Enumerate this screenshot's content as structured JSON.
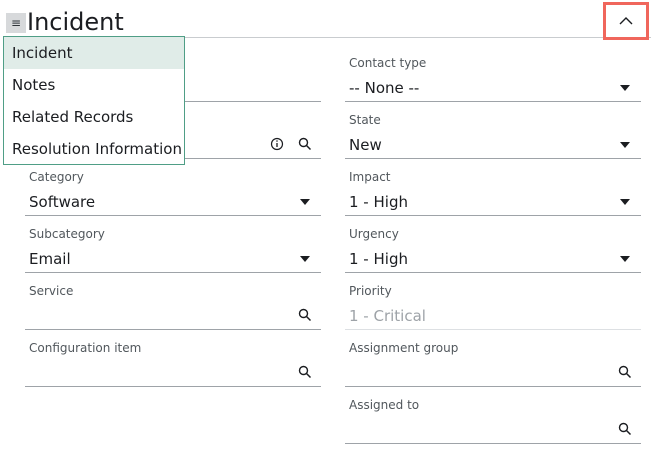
{
  "header": {
    "title": "Incident",
    "menu_glyph": "≡",
    "menu_icon": "hamburger-icon",
    "collapse_icon": "chevron-up-icon"
  },
  "section_menu": {
    "items": [
      {
        "label": "Incident",
        "active": true
      },
      {
        "label": "Notes",
        "active": false
      },
      {
        "label": "Related Records",
        "active": false
      },
      {
        "label": "Resolution Information",
        "active": false
      }
    ]
  },
  "form": {
    "left": {
      "category": {
        "label": "Category",
        "value": "Software"
      },
      "subcategory": {
        "label": "Subcategory",
        "value": "Email"
      },
      "service": {
        "label": "Service",
        "value": ""
      },
      "configuration_item": {
        "label": "Configuration item",
        "value": ""
      }
    },
    "right": {
      "contact_type": {
        "label": "Contact type",
        "value": "-- None --"
      },
      "state": {
        "label": "State",
        "value": "New"
      },
      "impact": {
        "label": "Impact",
        "value": "1 - High"
      },
      "urgency": {
        "label": "Urgency",
        "value": "1 - High"
      },
      "priority": {
        "label": "Priority",
        "value": "1 - Critical"
      },
      "assignment_group": {
        "label": "Assignment group",
        "value": ""
      },
      "assigned_to": {
        "label": "Assigned to",
        "value": ""
      }
    }
  },
  "colors": {
    "collapse_highlight": "#f0665c",
    "menu_border": "#4f9e86",
    "menu_active_bg": "#e0ece8"
  }
}
